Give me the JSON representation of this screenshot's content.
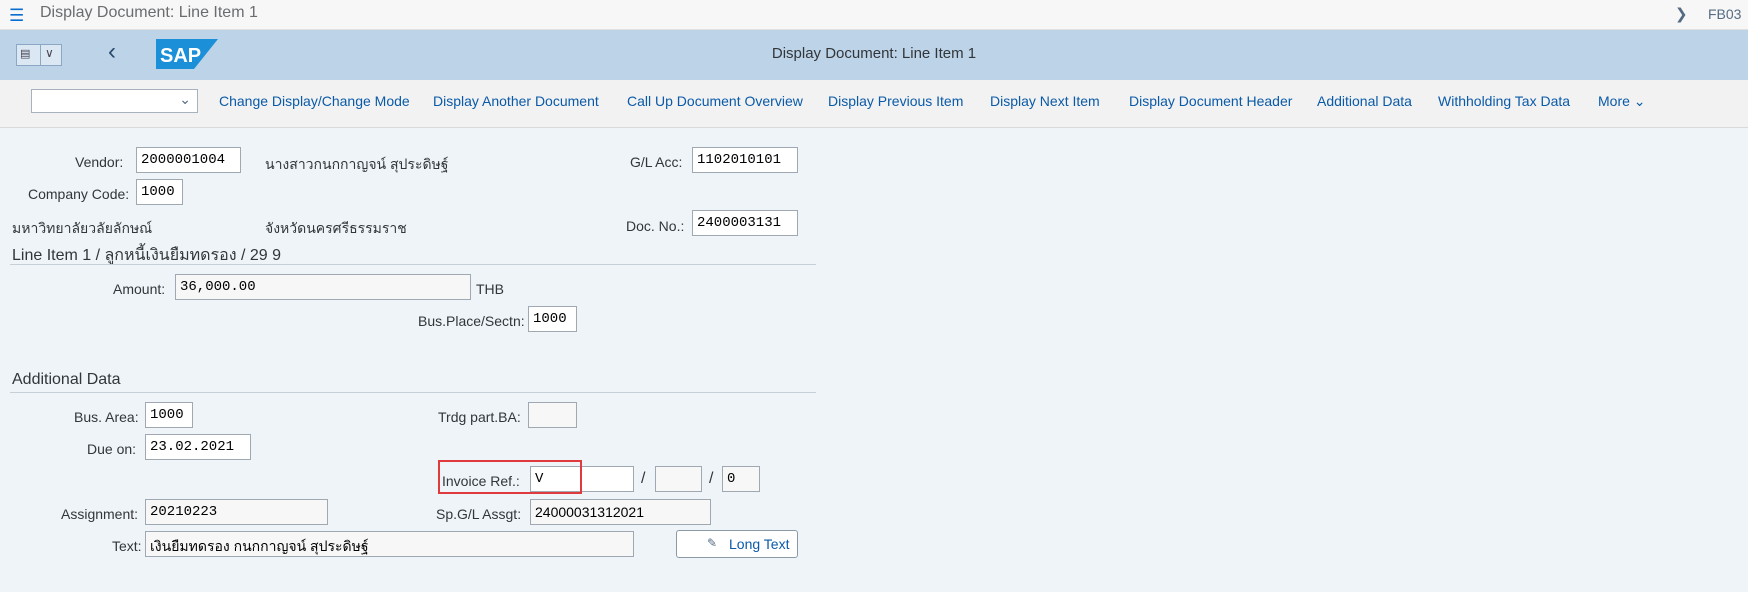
{
  "window": {
    "title": "Display Document: Line Item 1",
    "tcode": "FB03"
  },
  "header": {
    "title": "Display Document: Line Item 1",
    "logo": "SAP"
  },
  "toolbar": {
    "dropdown_value": "",
    "buttons": [
      "Change Display/Change Mode",
      "Display Another Document",
      "Call Up Document Overview",
      "Display Previous Item",
      "Display Next Item",
      "Display Document Header",
      "Additional Data",
      "Withholding Tax Data",
      "More"
    ]
  },
  "doc": {
    "vendor_label": "Vendor:",
    "vendor_value": "2000001004",
    "vendor_name": "นางสาวกนกกาญจน์ สุประดิษฐ์",
    "gl_label": "G/L Acc:",
    "gl_value": "1102010101",
    "company_label": "Company Code:",
    "company_value": "1000",
    "company_name": "มหาวิทยาลัยวลัยลักษณ์",
    "city": "จังหวัดนครศรีธรรมราช",
    "docno_label": "Doc. No.:",
    "docno_value": "2400003131"
  },
  "line_item": {
    "section_title": "Line Item 1 / ลูกหนี้เงินยืมทดรอง / 29 9",
    "amount_label": "Amount:",
    "amount_value": "36,000.00",
    "currency": "THB",
    "bus_place_label": "Bus.Place/Sectn:",
    "bus_place_value": "1000"
  },
  "additional": {
    "section_title": "Additional Data",
    "bus_area_label": "Bus. Area:",
    "bus_area_value": "1000",
    "trdg_label": "Trdg part.BA:",
    "trdg_value": "",
    "due_label": "Due on:",
    "due_value": "23.02.2021",
    "invoice_label": "Invoice Ref.:",
    "invoice_value": "V",
    "invoice_year": "",
    "invoice_item": "0",
    "assignment_label": "Assignment:",
    "assignment_value": "20210223",
    "spgl_label": "Sp.G/L Assgt:",
    "spgl_value": "24000031312021",
    "text_label": "Text:",
    "text_value": "เงินยืมทดรอง กนกกาญจน์ สุประดิษฐ์",
    "long_text_label": "Long Text"
  },
  "colors": {
    "shell": "#bcd3e8",
    "link": "#0a5aa8",
    "highlight": "#e0393e"
  }
}
